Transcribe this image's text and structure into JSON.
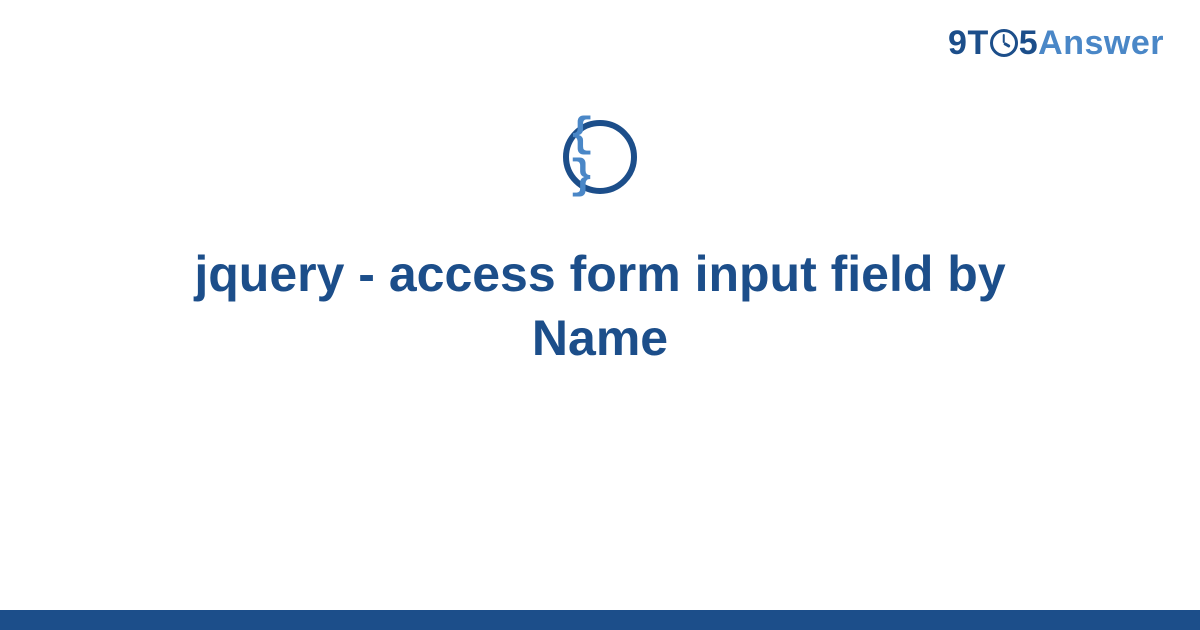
{
  "brand": {
    "part_nine": "9",
    "part_t": "T",
    "part_five": "5",
    "part_answer": "Answer"
  },
  "badge": {
    "glyph": "{ }"
  },
  "title": "jquery - access form input field by Name",
  "colors": {
    "primary": "#1c4e8a",
    "accent": "#4a87c7"
  }
}
